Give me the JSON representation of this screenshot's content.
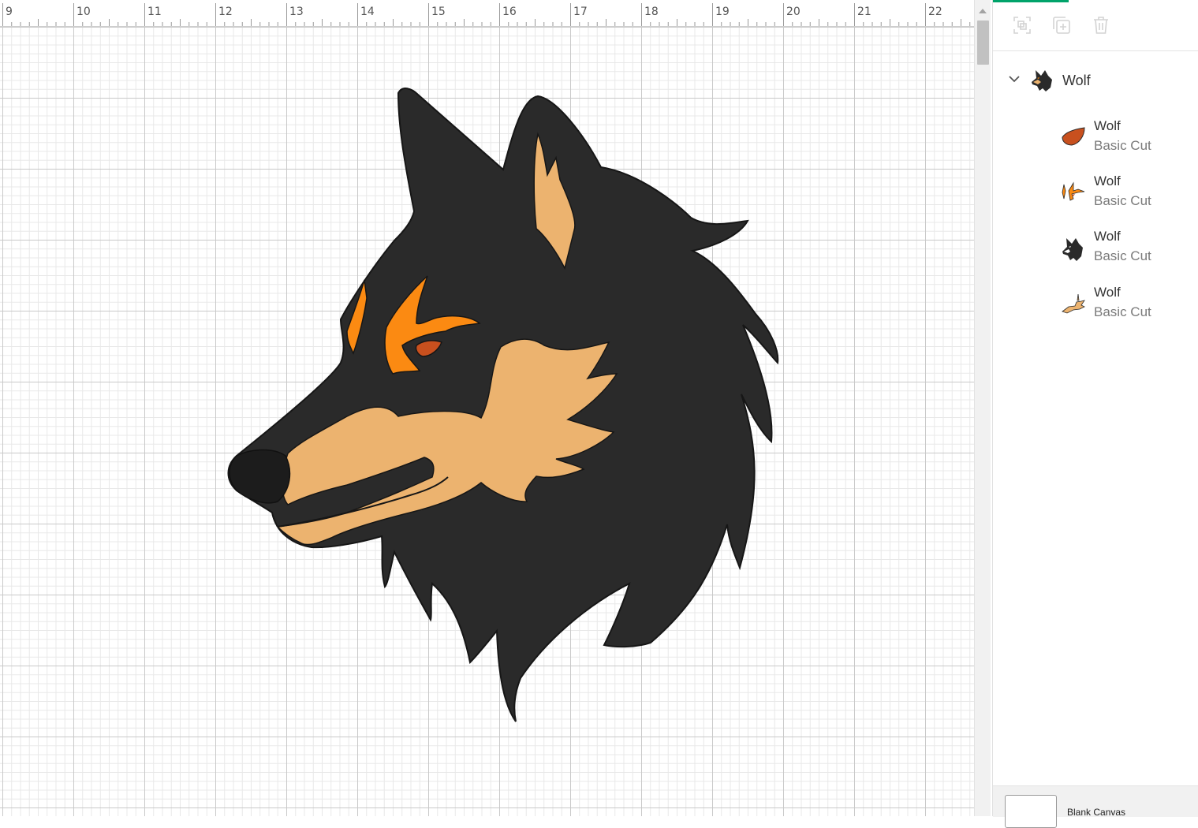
{
  "canvas": {
    "ruler_numbers": [
      "9",
      "10",
      "11",
      "12",
      "13",
      "14",
      "15",
      "16",
      "17",
      "18",
      "19",
      "20",
      "21",
      "22"
    ]
  },
  "colors": {
    "accent": "#00a36a",
    "wolf_black": "#2a2a2a",
    "wolf_tan": "#ecb36f",
    "wolf_orange": "#fb8a12",
    "wolf_eye": "#c8501e"
  },
  "layers_panel": {
    "toolbar": {
      "group_icon": "group-icon",
      "duplicate_icon": "duplicate-icon",
      "delete_icon": "trash-icon"
    },
    "group": {
      "label": "Wolf",
      "expanded": true
    },
    "layers": [
      {
        "name": "Wolf",
        "operation": "Basic Cut",
        "thumb": "eye-shape",
        "color": "#c8501e"
      },
      {
        "name": "Wolf",
        "operation": "Basic Cut",
        "thumb": "brow-shapes",
        "color": "#fb8a12"
      },
      {
        "name": "Wolf",
        "operation": "Basic Cut",
        "thumb": "wolf-head",
        "color": "#2a2a2a"
      },
      {
        "name": "Wolf",
        "operation": "Basic Cut",
        "thumb": "tan-pieces",
        "color": "#ecb36f"
      }
    ],
    "footer": {
      "label": "Blank Canvas"
    }
  }
}
